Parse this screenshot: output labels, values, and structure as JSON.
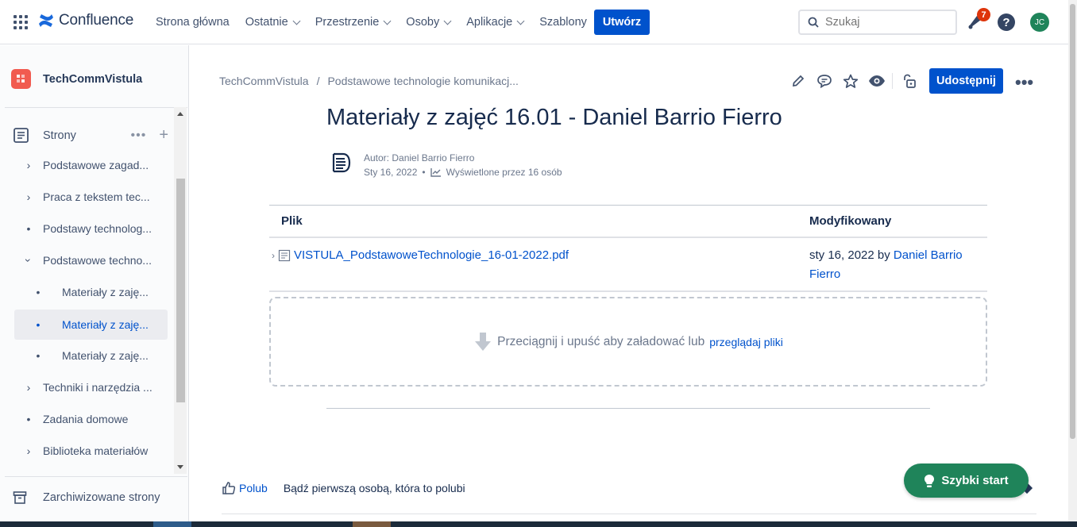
{
  "topbar": {
    "app_name": "Confluence",
    "nav": [
      {
        "label": "Strona główna",
        "dropdown": false
      },
      {
        "label": "Ostatnie",
        "dropdown": true
      },
      {
        "label": "Przestrzenie",
        "dropdown": true
      },
      {
        "label": "Osoby",
        "dropdown": true
      },
      {
        "label": "Aplikacje",
        "dropdown": true
      },
      {
        "label": "Szablony",
        "dropdown": false
      }
    ],
    "create_label": "Utwórz",
    "search_placeholder": "Szukaj",
    "notification_count": "7",
    "help_label": "?",
    "avatar_initials": "JC"
  },
  "sidebar": {
    "space_name": "TechCommVistula",
    "pages_label": "Strony",
    "pages_more": "•••",
    "pages_add": "+",
    "tree": [
      {
        "label": "Podstawowe zagad...",
        "marker": "chevron-right",
        "level": 0,
        "selected": false
      },
      {
        "label": "Praca z tekstem tec...",
        "marker": "chevron-right",
        "level": 0,
        "selected": false
      },
      {
        "label": "Podstawy technolog...",
        "marker": "bullet",
        "level": 0,
        "selected": false
      },
      {
        "label": "Podstawowe techno...",
        "marker": "chevron-down",
        "level": 0,
        "selected": false
      },
      {
        "label": "Materiały z zaję...",
        "marker": "bullet",
        "level": 1,
        "selected": false
      },
      {
        "label": "Materiały z zaję...",
        "marker": "bullet",
        "level": 1,
        "selected": true
      },
      {
        "label": "Materiały z zaję...",
        "marker": "bullet",
        "level": 1,
        "selected": false
      },
      {
        "label": "Techniki i narzędzia ...",
        "marker": "chevron-right",
        "level": 0,
        "selected": false
      },
      {
        "label": "Zadania domowe",
        "marker": "bullet",
        "level": 0,
        "selected": false
      },
      {
        "label": "Biblioteka materiałów",
        "marker": "chevron-right",
        "level": 0,
        "selected": false
      }
    ],
    "archived_label": "Zarchiwizowane strony"
  },
  "breadcrumb": {
    "space": "TechCommVistula",
    "separator": "/",
    "parent": "Podstawowe technologie komunikacj..."
  },
  "actions": {
    "share_label": "Udostępnij",
    "more_label": "•••"
  },
  "page": {
    "title": "Materiały z zajęć 16.01 - Daniel Barrio Fierro",
    "author_line": "Autor: Daniel Barrio Fierro",
    "date": "Sty 16, 2022",
    "date_sep": "•",
    "views": "Wyświetlone przez 16 osób"
  },
  "attachments": {
    "headers": {
      "file": "Plik",
      "modified": "Modyfikowany"
    },
    "rows": [
      {
        "file_name": "VISTULA_PodstawoweTechnologie_16-01-2022.pdf",
        "modified_date": "sty 16, 2022",
        "modified_by_word": "by",
        "modified_by": "Daniel Barrio Fierro"
      }
    ],
    "dropzone_text": "Przeciągnij i upuść aby załadować lub",
    "dropzone_link": "przeglądaj pliki"
  },
  "footer": {
    "like_label": "Polub",
    "like_info": "Bądź pierwszą osobą, która to polubi"
  },
  "quickstart_label": "Szybki start",
  "colors": {
    "primary": "#0052cc",
    "quickstart": "#1f845a",
    "space_icon": "#f15b50",
    "badge": "#de350b"
  }
}
